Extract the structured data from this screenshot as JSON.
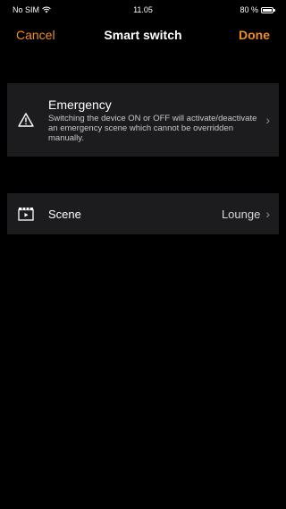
{
  "status": {
    "carrier": "No SIM",
    "time": "11.05",
    "battery": "80 %"
  },
  "nav": {
    "cancel_label": "Cancel",
    "title": "Smart switch",
    "done_label": "Done"
  },
  "emergency": {
    "icon": "warning-triangle-icon",
    "title": "Emergency",
    "description": "Switching the device ON or OFF will activate/deactivate an emergency scene which cannot be overridden manually."
  },
  "scene": {
    "icon": "clapperboard-icon",
    "label": "Scene",
    "value": "Lounge"
  },
  "colors": {
    "accent": "#f08d1c",
    "background": "#000000",
    "cell": "#1c1c1e"
  }
}
